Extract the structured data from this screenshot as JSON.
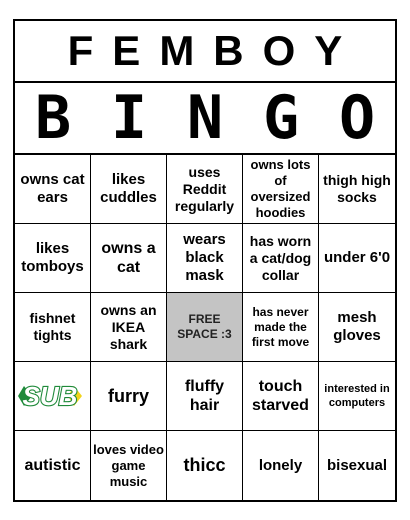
{
  "title": "FEMBOY",
  "bingo_letters": [
    "B",
    "I",
    "N",
    "G",
    "O"
  ],
  "cells": [
    "owns cat ears",
    "likes cuddles",
    "uses Reddit regularly",
    "owns lots of oversized hoodies",
    "thigh high socks",
    "likes tomboys",
    "owns a cat",
    "wears black mask",
    "has worn a cat/dog collar",
    "under 6'0",
    "fishnet tights",
    "owns an IKEA shark",
    "FREE SPACE :3",
    "has never made the first move",
    "mesh gloves",
    "SUB",
    "furry",
    "fluffy hair",
    "touch starved",
    "interested in computers",
    "autistic",
    "loves video game music",
    "thicc",
    "lonely",
    "bisexual"
  ],
  "colors": {
    "grid": "#000000",
    "free_space": "#c4c4c4",
    "logo_green": "#1f8a3a",
    "logo_yellow": "#f2d41a"
  },
  "logo_icon": "subway-logo"
}
